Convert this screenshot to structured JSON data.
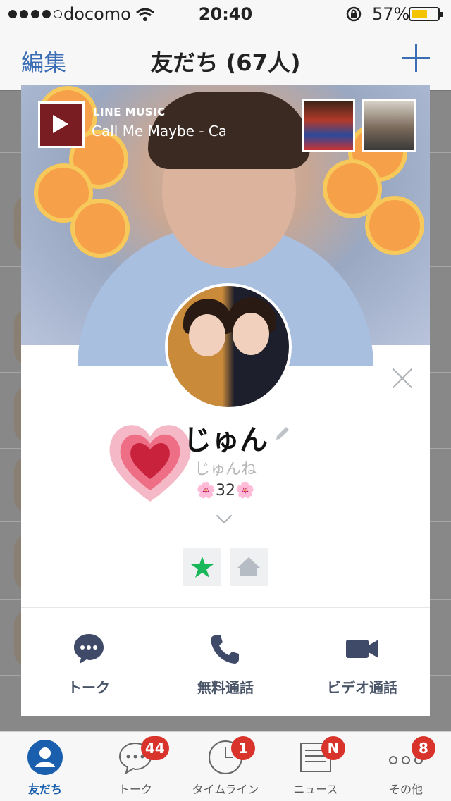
{
  "status_bar": {
    "carrier": "docomo",
    "time": "20:40",
    "battery": "57%",
    "battery_level": 0.57
  },
  "nav": {
    "edit_label": "編集",
    "title": "友だち (67人)"
  },
  "profile": {
    "music_service": "LINE MUSIC",
    "song": "Call Me Maybe - Carly Rae Jepsen",
    "name": "じゅん",
    "subname": "じゅんね",
    "status_message": "🌸32🌸",
    "actions": [
      {
        "label": "トーク",
        "icon": "chat-bubble-icon"
      },
      {
        "label": "無料通話",
        "icon": "phone-icon"
      },
      {
        "label": "ビデオ通話",
        "icon": "video-camera-icon"
      }
    ]
  },
  "tabbar": {
    "items": [
      {
        "label": "友だち",
        "badge": ""
      },
      {
        "label": "トーク",
        "badge": "44"
      },
      {
        "label": "タイムライン",
        "badge": "1"
      },
      {
        "label": "ニュース",
        "badge": "N"
      },
      {
        "label": "その他",
        "badge": "8"
      }
    ]
  },
  "colors": {
    "accent": "#3b6db4",
    "badge": "#d9342b",
    "favorite_star": "#18b85a"
  }
}
